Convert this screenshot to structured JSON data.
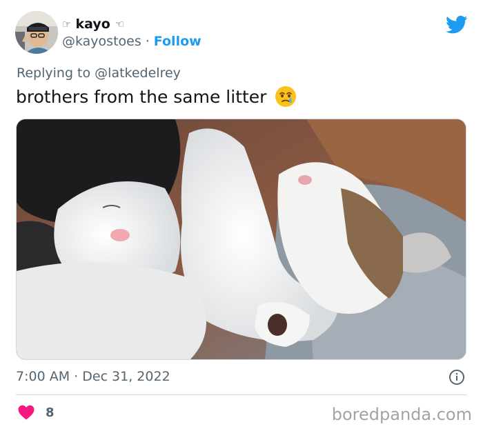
{
  "author": {
    "hand_left": "☞",
    "display_name": "kayo",
    "hand_right": "☜",
    "handle": "@kayostoes",
    "separator": "·",
    "follow_label": "Follow"
  },
  "reply": {
    "prefix": "Replying to",
    "mention": "@latkedelrey"
  },
  "tweet": {
    "text": "brothers from the same litter",
    "emoji": "face-holding-back-tears"
  },
  "photo": {
    "subject": "two sleeping kittens"
  },
  "meta": {
    "time": "7:00 AM",
    "separator": "·",
    "date": "Dec 31, 2022"
  },
  "engagement": {
    "likes": "8"
  },
  "watermark": "boredpanda.com",
  "colors": {
    "brand_blue": "#1d9bf0",
    "like_pink": "#f91880",
    "secondary_text": "#536471"
  }
}
